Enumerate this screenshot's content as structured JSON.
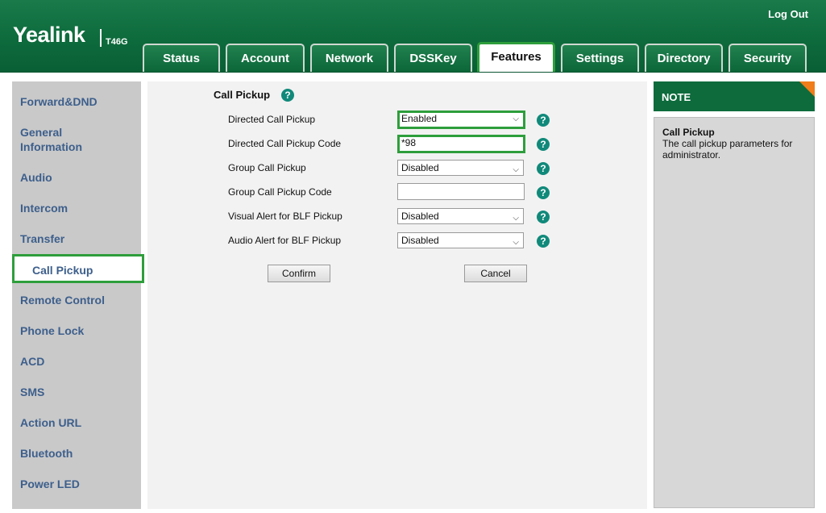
{
  "header": {
    "brand": "Yealink",
    "model": "T46G",
    "logout": "Log Out"
  },
  "tabs": [
    {
      "label": "Status"
    },
    {
      "label": "Account"
    },
    {
      "label": "Network"
    },
    {
      "label": "DSSKey"
    },
    {
      "label": "Features",
      "active": true
    },
    {
      "label": "Settings"
    },
    {
      "label": "Directory"
    },
    {
      "label": "Security"
    }
  ],
  "sidebar": {
    "items": [
      {
        "label": "Forward&DND"
      },
      {
        "label": "General\nInformation"
      },
      {
        "label": "Audio"
      },
      {
        "label": "Intercom"
      },
      {
        "label": "Transfer"
      },
      {
        "label": "Call Pickup",
        "active": true
      },
      {
        "label": "Remote Control"
      },
      {
        "label": "Phone Lock"
      },
      {
        "label": "ACD"
      },
      {
        "label": "SMS"
      },
      {
        "label": "Action URL"
      },
      {
        "label": "Bluetooth"
      },
      {
        "label": "Power LED"
      }
    ]
  },
  "main": {
    "section_title": "Call Pickup",
    "rows": [
      {
        "label": "Directed Call Pickup",
        "type": "select",
        "value": "Enabled"
      },
      {
        "label": "Directed Call Pickup Code",
        "type": "text",
        "value": "*98"
      },
      {
        "label": "Group Call Pickup",
        "type": "select",
        "value": "Disabled"
      },
      {
        "label": "Group Call Pickup Code",
        "type": "text",
        "value": ""
      },
      {
        "label": "Visual Alert for BLF Pickup",
        "type": "select",
        "value": "Disabled"
      },
      {
        "label": "Audio Alert for BLF Pickup",
        "type": "select",
        "value": "Disabled"
      }
    ],
    "confirm_label": "Confirm",
    "cancel_label": "Cancel"
  },
  "note": {
    "heading": "NOTE",
    "title": "Call Pickup",
    "text": "The call pickup parameters for administrator."
  },
  "colors": {
    "brand_green": "#0d6b3c",
    "highlight_green": "#2e9e3c",
    "help_teal": "#10897a",
    "nav_text": "#3d5f8c",
    "note_corner": "#f07d1a"
  }
}
